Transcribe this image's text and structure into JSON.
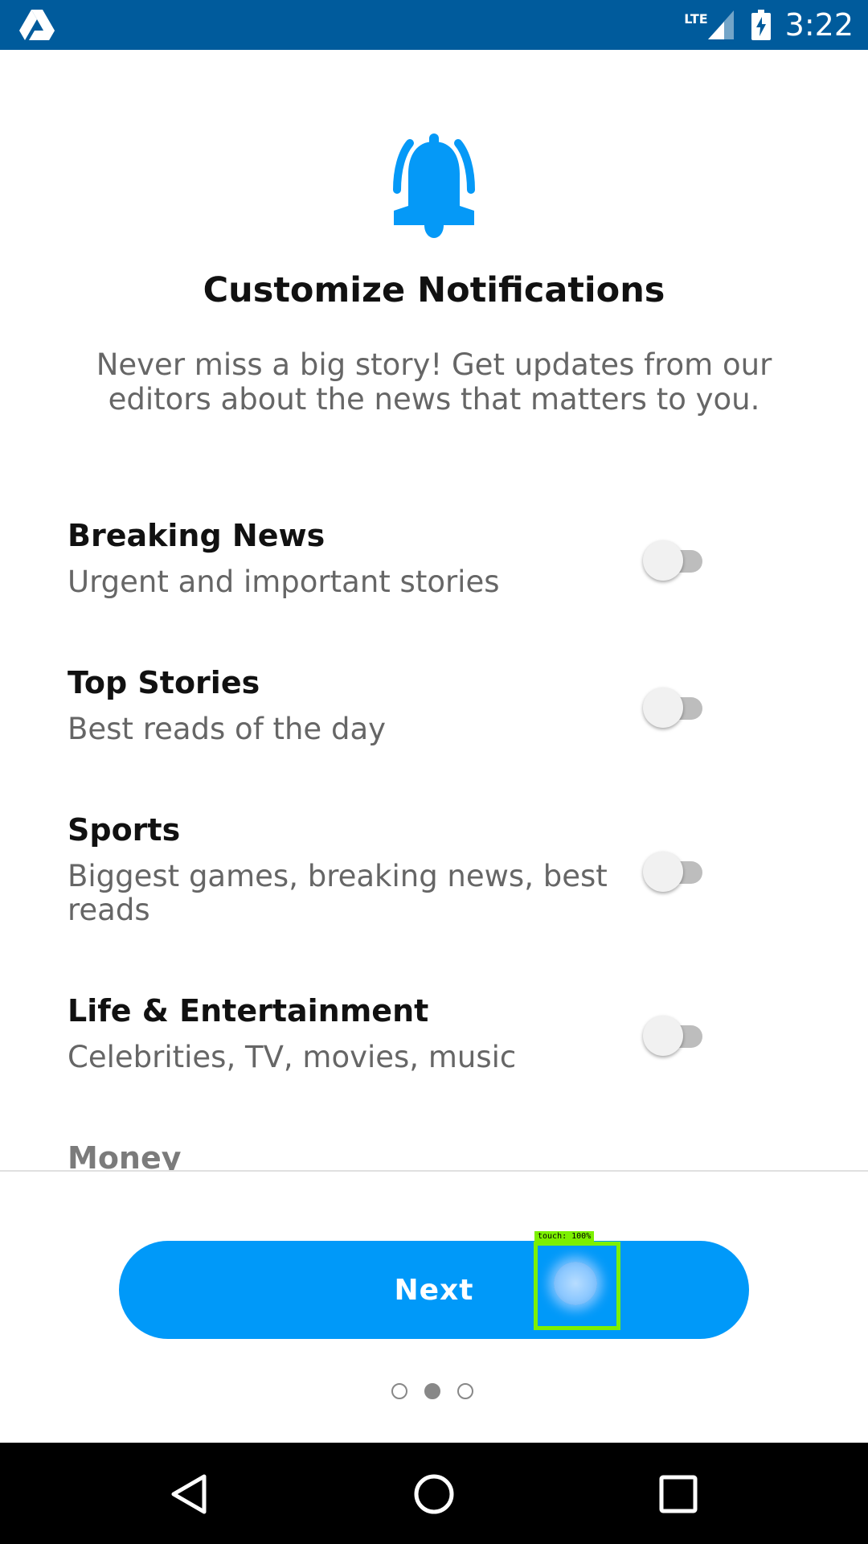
{
  "status_bar": {
    "network": "LTE",
    "time": "3:22",
    "background_color": "#005b9c"
  },
  "header": {
    "icon": "bell-icon",
    "title": "Customize Notifications",
    "subtitle": "Never miss a big story! Get updates from our editors about the news that matters to you."
  },
  "notification_options": [
    {
      "title": "Breaking News",
      "description": "Urgent and important stories",
      "enabled": false
    },
    {
      "title": "Top Stories",
      "description": "Best reads of the day",
      "enabled": false
    },
    {
      "title": "Sports",
      "description": "Biggest games, breaking news, best reads",
      "enabled": false
    },
    {
      "title": "Life & Entertainment",
      "description": "Celebrities, TV, movies, music",
      "enabled": false
    },
    {
      "title": "Money",
      "description": "",
      "enabled": false
    }
  ],
  "footer": {
    "next_label": "Next",
    "accent_color": "#0099f9",
    "page_indicator": {
      "total": 3,
      "current": 2
    }
  },
  "touch_overlay": {
    "label": "touch: 100%"
  },
  "nav_bar": {
    "icons": [
      "back-icon",
      "home-icon",
      "recents-icon"
    ]
  }
}
